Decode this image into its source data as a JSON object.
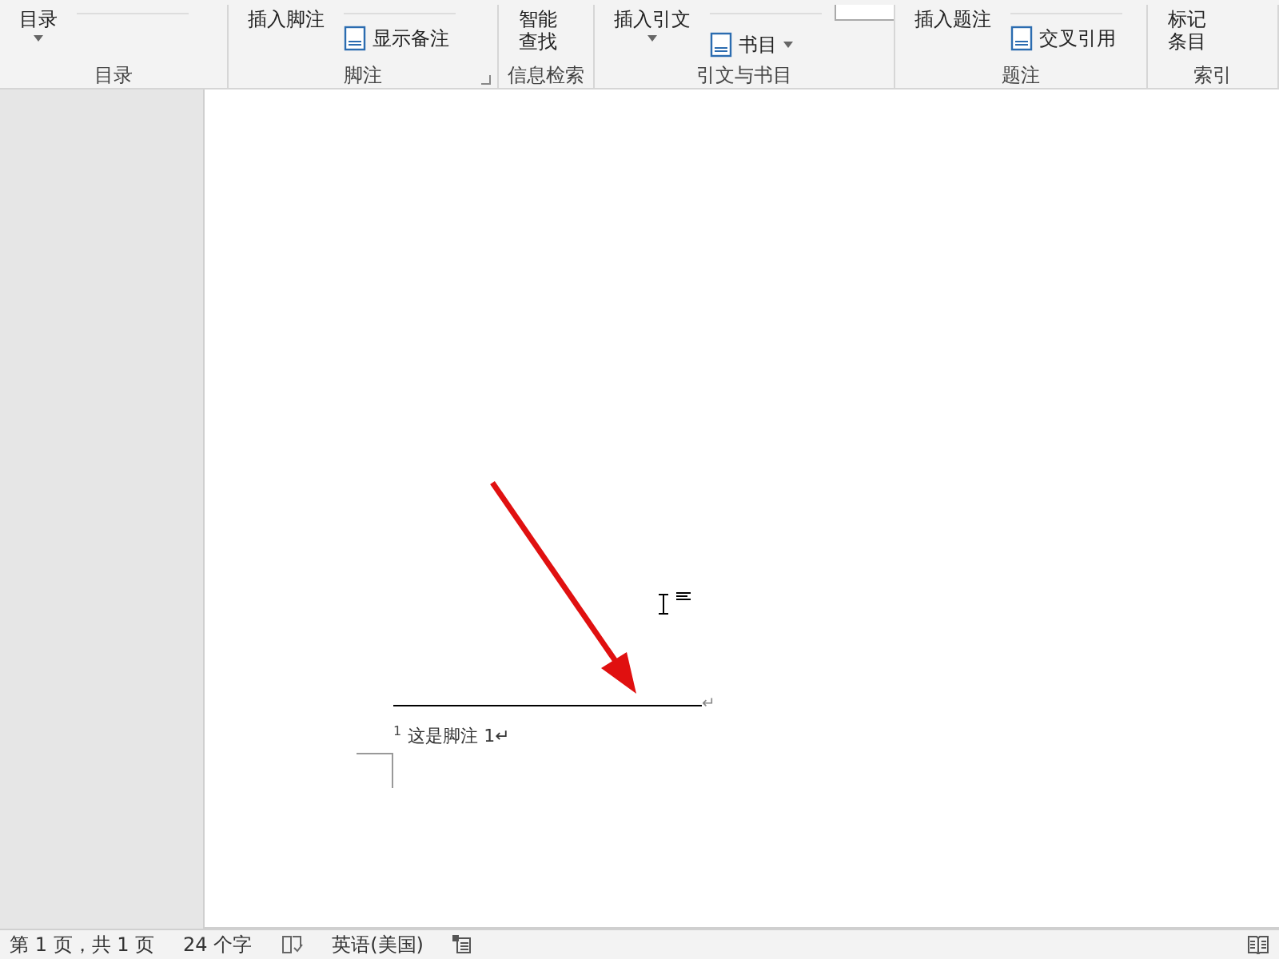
{
  "ribbon": {
    "groups": [
      {
        "label": "目录",
        "items": [
          {
            "kind": "big",
            "text": "目录",
            "dropdown": true
          },
          {
            "kind": "cut"
          }
        ]
      },
      {
        "label": "脚注",
        "launcher": true,
        "items": [
          {
            "kind": "big",
            "text": "插入脚注"
          },
          {
            "kind": "cut"
          },
          {
            "kind": "small",
            "text": "显示备注"
          }
        ]
      },
      {
        "label": "信息检索",
        "items": [
          {
            "kind": "stack",
            "text": "智能查找"
          }
        ]
      },
      {
        "label": "引文与书目",
        "items": [
          {
            "kind": "big",
            "text": "插入引文",
            "dropdown": true
          },
          {
            "kind": "cut"
          },
          {
            "kind": "cutfield"
          },
          {
            "kind": "small",
            "text": "书目",
            "dropdown": true
          }
        ]
      },
      {
        "label": "题注",
        "items": [
          {
            "kind": "big",
            "text": "插入题注"
          },
          {
            "kind": "cut"
          },
          {
            "kind": "small",
            "text": "交叉引用"
          }
        ]
      },
      {
        "label": "索引",
        "items": [
          {
            "kind": "stack",
            "text": "标记条目"
          }
        ]
      }
    ]
  },
  "document": {
    "separator_mark": "↵",
    "footnote": {
      "number": "1",
      "text": "这是脚注 1↵"
    }
  },
  "status_bar": {
    "page": "第 1 页，共 1 页",
    "words": "24 个字",
    "language": "英语(美国)"
  }
}
